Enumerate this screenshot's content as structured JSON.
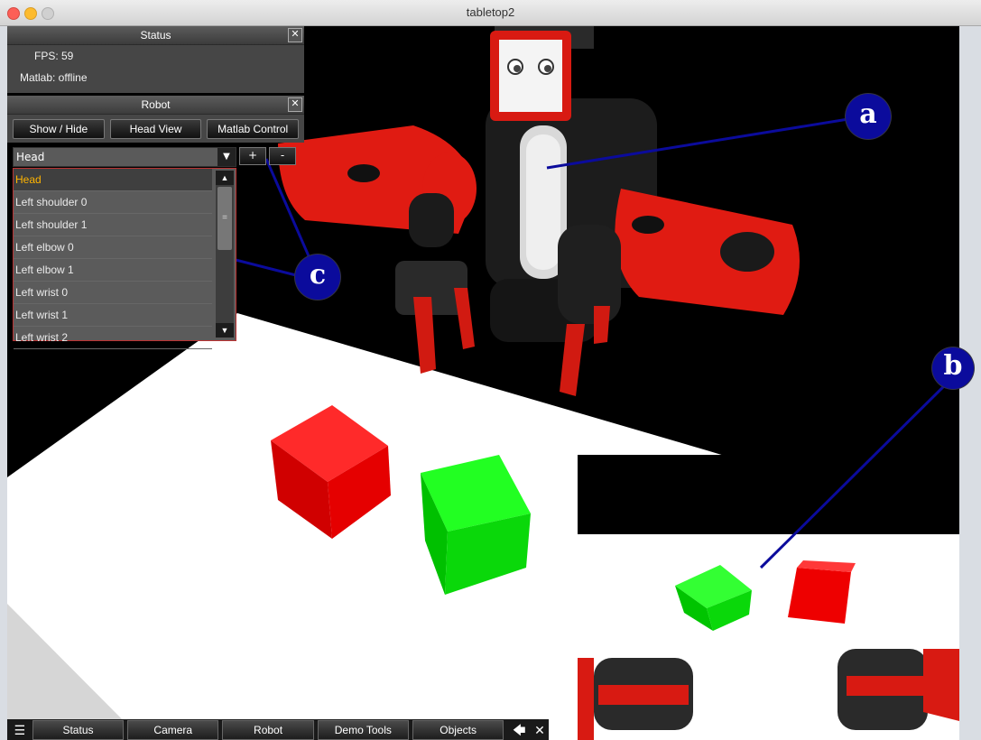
{
  "window": {
    "title": "tabletop2"
  },
  "status_panel": {
    "title": "Status",
    "fps": "FPS: 59",
    "matlab": "Matlab: offline"
  },
  "robot_panel": {
    "title": "Robot",
    "buttons": [
      "Show / Hide",
      "Head View",
      "Matlab Control"
    ],
    "joint_select_value": "Head",
    "plus_label": "+",
    "minus_label": "-",
    "joint_options": [
      "Head",
      "Left shoulder 0",
      "Left shoulder 1",
      "Left elbow 0",
      "Left elbow 1",
      "Left wrist 0",
      "Left wrist 1",
      "Left wrist 2"
    ]
  },
  "toolbar": {
    "items": [
      "Status",
      "Camera",
      "Robot",
      "Demo Tools",
      "Objects"
    ]
  },
  "callouts": {
    "a": "a",
    "b": "b",
    "c": "c"
  },
  "colors": {
    "robot_red": "#e01b12",
    "cube_red": "#ee0000",
    "cube_green": "#14e014",
    "callout_blue": "#0b0b9c"
  }
}
